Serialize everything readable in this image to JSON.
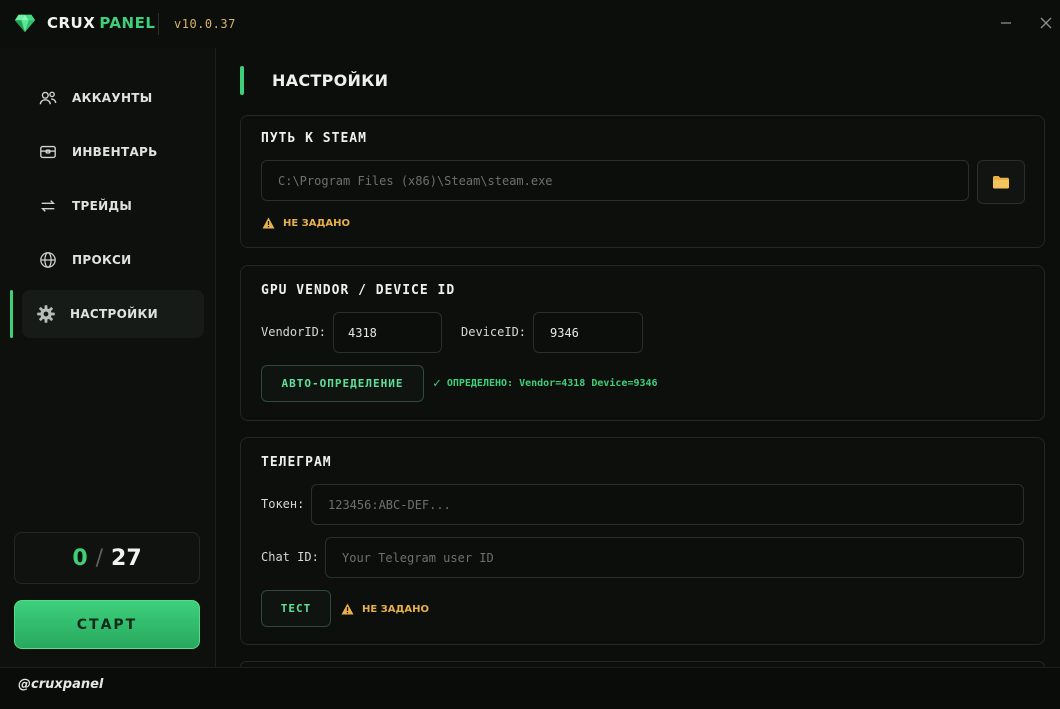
{
  "titlebar": {
    "brand_primary": "CRUX",
    "brand_accent": "PANEL",
    "version": "v10.0.37",
    "minimize_icon": "minimize-icon",
    "close_icon": "close-icon"
  },
  "sidebar": {
    "items": [
      {
        "label": "АККАУНТЫ",
        "icon": "users-icon",
        "active": false
      },
      {
        "label": "ИНВЕНТАРЬ",
        "icon": "inventory-icon",
        "active": false
      },
      {
        "label": "ТРЕЙДЫ",
        "icon": "swap-arrows-icon",
        "active": false
      },
      {
        "label": "ПРОКСИ",
        "icon": "globe-icon",
        "active": false
      },
      {
        "label": "НАСТРОЙКИ",
        "icon": "gear-icon",
        "active": true
      }
    ],
    "counter": {
      "current": "0",
      "separator": "/",
      "total": "27"
    },
    "start_label": "СТАРТ"
  },
  "footer": {
    "handle": "@cruxpanel"
  },
  "page": {
    "title": "НАСТРОЙКИ"
  },
  "steam": {
    "title": "ПУТЬ К STEAM",
    "path_placeholder": "C:\\Program Files (x86)\\Steam\\steam.exe",
    "status": "НЕ ЗАДАНО"
  },
  "gpu": {
    "title": "GPU VENDOR / DEVICE ID",
    "vendor_label": "VendorID:",
    "vendor_value": "4318",
    "device_label": "DeviceID:",
    "device_value": "9346",
    "auto_button": "АВТО-ОПРЕДЕЛЕНИЕ",
    "status": "ОПРЕДЕЛЕНО: Vendor=4318 Device=9346"
  },
  "telegram": {
    "title": "ТЕЛЕГРАМ",
    "token_label": "Токен:",
    "token_placeholder": "123456:ABC-DEF...",
    "chat_label": "Chat ID:",
    "chat_placeholder": "Your Telegram user ID",
    "test_button": "ТЕСТ",
    "status": "НЕ ЗАДАНО"
  },
  "colors": {
    "accent": "#3ecf7a",
    "warning": "#e6b04a",
    "version": "#d8b36a",
    "background": "#0c0e0c"
  }
}
